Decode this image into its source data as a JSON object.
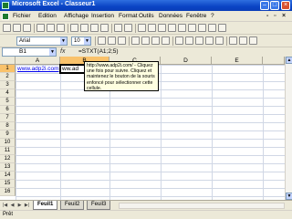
{
  "window": {
    "title": "Microsoft Excel - Classeur1"
  },
  "menu": [
    "Fichier",
    "Edition",
    "Affichage",
    "Insertion",
    "Format",
    "Outils",
    "Données",
    "Fenêtre",
    "?"
  ],
  "toolbar": {
    "font": "Arial",
    "size": "10"
  },
  "formula_bar": {
    "name_box": "B1",
    "fx": "fx",
    "formula": "=STXT(A1;2;5)"
  },
  "columns": [
    "A",
    "B",
    "C",
    "D",
    "E"
  ],
  "rows": [
    "1",
    "2",
    "3",
    "4",
    "5",
    "6",
    "7",
    "8",
    "9",
    "10",
    "11",
    "12",
    "13",
    "14",
    "15",
    "16"
  ],
  "cells": {
    "A1": "www.adp2i.com",
    "B1": "ww.ad"
  },
  "tooltip": "http://www.adp2i.com/ - Cliquez une fois pour suivre. Cliquez et maintenez le bouton de la souris enfoncé pour sélectionner cette cellule.",
  "sheets": [
    "Feuil1",
    "Feuil2",
    "Feuil3"
  ],
  "active_sheet": "Feuil1",
  "status": "Prêt",
  "colors": {
    "title_bar": "#0a44c4",
    "header_selected": "#f9c26b",
    "hyperlink": "#0000ee",
    "tooltip_bg": "#ffffe1"
  }
}
